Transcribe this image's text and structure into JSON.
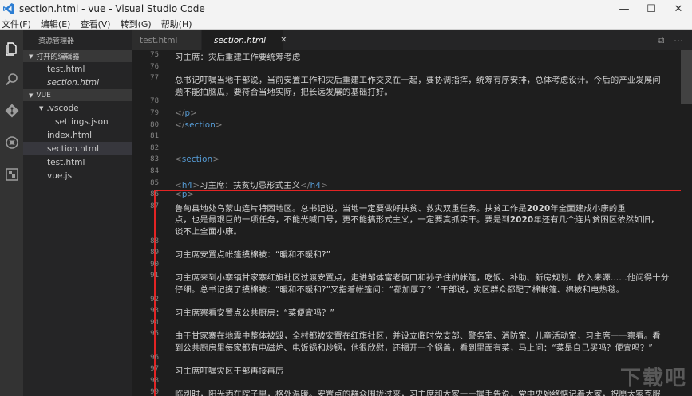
{
  "window": {
    "title": "section.html - vue - Visual Studio Code",
    "controls": {
      "minimize": "—",
      "maximize": "☐",
      "close": "✕"
    }
  },
  "menu": [
    "文件(F)",
    "编辑(E)",
    "查看(V)",
    "转到(G)",
    "帮助(H)"
  ],
  "activity_icons": [
    "explorer-icon",
    "search-icon",
    "git-icon",
    "debug-icon",
    "extensions-icon"
  ],
  "sidebar": {
    "header": "资源管理器",
    "open_editors_label": "打开的编辑器",
    "open_editors": [
      {
        "label": "test.html"
      },
      {
        "label": "section.html"
      }
    ],
    "project_label": "VUE",
    "tree": [
      {
        "label": ".vscode",
        "indent": 1,
        "folder": true
      },
      {
        "label": "settings.json",
        "indent": 2
      },
      {
        "label": "index.html",
        "indent": 1
      },
      {
        "label": "section.html",
        "indent": 1,
        "active": true
      },
      {
        "label": "test.html",
        "indent": 1
      },
      {
        "label": "vue.js",
        "indent": 1
      }
    ]
  },
  "tabs": [
    {
      "label": "test.html",
      "active": false
    },
    {
      "label": "section.html",
      "active": true,
      "close": "✕"
    }
  ],
  "tab_actions": [
    "split-editor-icon",
    "more-icon"
  ],
  "tab_action_glyphs": [
    "⧉",
    "⋯"
  ],
  "editor": {
    "lines": [
      {
        "num": "75",
        "text": "习主席：灾后重建工作要统筹考虑"
      },
      {
        "num": "76",
        "text": ""
      },
      {
        "num": "77",
        "text": "总书记叮嘱当地干部说，当前安置工作和灾后重建工作交叉在一起，要协调指挥，统筹有序安排，总体考虑设计。今后的产业发展问"
      },
      {
        "num": "",
        "text": "题不能拍脑瓜，要符合当地实际，把长远发展的基础打好。"
      },
      {
        "num": "78",
        "text": ""
      },
      {
        "num": "79",
        "text": "        </p>"
      },
      {
        "num": "80",
        "text": "        </section>"
      },
      {
        "num": "81",
        "text": ""
      },
      {
        "num": "82",
        "text": ""
      },
      {
        "num": "83",
        "text": "        <section>"
      },
      {
        "num": "84",
        "text": ""
      },
      {
        "num": "85",
        "text": "          <h4>习主席：扶贫切忌形式主义</h4>"
      },
      {
        "num": "86",
        "text": "        <p>"
      },
      {
        "num": "87",
        "text": "        鲁甸县地处乌蒙山连片特困地区。总书记说，当地一定要做好扶贫、救灾双重任务。扶贫工作是2020年全面建成小康的重"
      },
      {
        "num": "",
        "text": "          点，也是最艰巨的一项任务，不能光喊口号，更不能搞形式主义，一定要真抓实干。要是到2020年还有几个连片贫困区依然如旧，"
      },
      {
        "num": "",
        "text": "          谈不上全面小康。"
      },
      {
        "num": "88",
        "text": ""
      },
      {
        "num": "89",
        "text": "习主席安置点帐篷摸棉被：“暖和不暖和?”"
      },
      {
        "num": "90",
        "text": ""
      },
      {
        "num": "91",
        "text": "习主席来到小寨镇甘家寨红旗社区过渡安置点，走进邹体富老俩口和孙子住的帐篷，吃饭、补助、新房规划、收入来源……他问得十分"
      },
      {
        "num": "",
        "text": "仔细。总书记摸了摸棉被：“暖和不暖和?”又指着帐篷问：“都加厚了？”干部说，灾区群众都配了棉帐篷、棉被和电热毯。"
      },
      {
        "num": "92",
        "text": ""
      },
      {
        "num": "93",
        "text": "习主席察看安置点公共厨房：“菜便宜吗？”"
      },
      {
        "num": "94",
        "text": ""
      },
      {
        "num": "95",
        "text": "由于甘家寨在地震中整体被毁，全村都被安置在红旗社区，并设立临时党支部、警务室、消防室、儿童活动室，习主席一一察看。看"
      },
      {
        "num": "",
        "text": "到公共厨房里每家都有电磁炉、电饭锅和炒锅，他很欣慰，还揭开一个锅盖，看到里面有菜，马上问：“菜是自己买吗？便宜吗？”"
      },
      {
        "num": "96",
        "text": ""
      },
      {
        "num": "97",
        "text": "习主席叮嘱灾区干部再接再厉"
      },
      {
        "num": "98",
        "text": ""
      },
      {
        "num": "99",
        "text": "临别时，阳光洒在院子里，格外温暖。安置点的群众围拢过来，习主席和大家一一握手告说，党中央始终惦记着大家，祝愿大家克服"
      }
    ]
  },
  "watermark": "下载吧"
}
